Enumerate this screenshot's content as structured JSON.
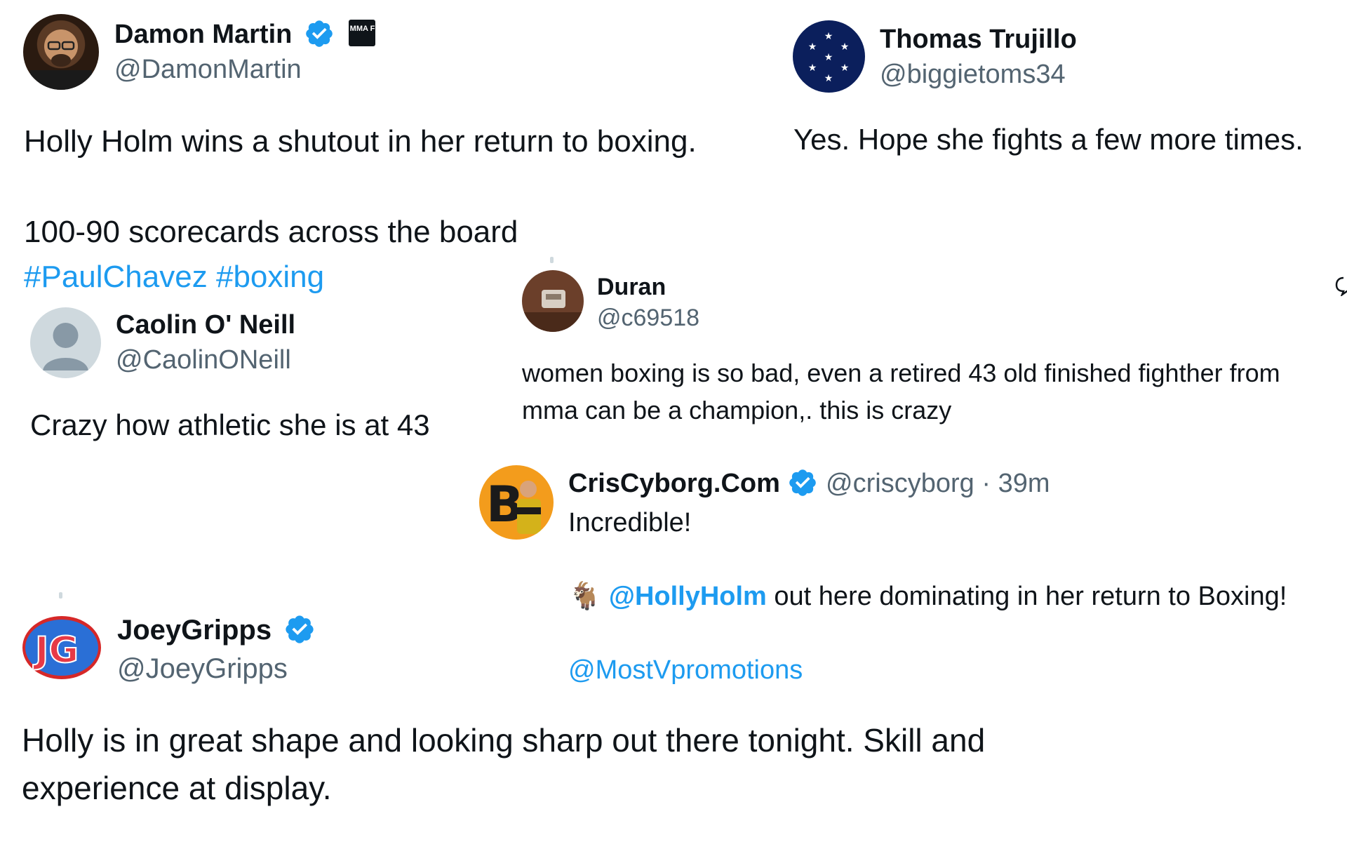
{
  "tweets": {
    "damon": {
      "name": "Damon Martin",
      "handle": "@DamonMartin",
      "line1": "Holly Holm wins a shutout in her return to boxing.",
      "line2": "100-90 scorecards across the board",
      "hashtag1": "#PaulChavez",
      "hashtag2": "#boxing",
      "affiliate_badge_text": "MMA F"
    },
    "thomas": {
      "name": "Thomas Trujillo",
      "handle": "@biggietoms34",
      "text": "Yes. Hope she fights a few more times."
    },
    "caolin": {
      "name": "Caolin O' Neill",
      "handle": "@CaolinONeill",
      "text": "Crazy how athletic she is at 43"
    },
    "duran": {
      "name": "Duran",
      "handle": "@c69518",
      "line1": "women boxing is so bad, even a retired 43 old finished fighther from",
      "line2": "mma can be a champion,. this is crazy"
    },
    "cris": {
      "name": "CrisCyborg.Com",
      "handle": "@criscyborg",
      "separator": "·",
      "time": "39m",
      "line1": "Incredible!",
      "goat_emoji": "🐐",
      "mention1": "@HollyHolm",
      "line2_rest": " out here dominating in her return to Boxing!",
      "mention2": "@MostVpromotions"
    },
    "joey": {
      "name": "JoeyGripps",
      "handle": "@JoeyGripps",
      "line1": "Holly is in great shape and looking sharp out there tonight. Skill and",
      "line2": "experience at display.",
      "avatar_text": "JG"
    }
  },
  "colors": {
    "text": "#0f1419",
    "secondary": "#536471",
    "link": "#1d9bf0",
    "verified": "#1d9bf0"
  },
  "icons": [
    "verified-badge-icon",
    "default-avatar-icon",
    "stars-avatar-icon",
    "chat-bubble-icon"
  ]
}
